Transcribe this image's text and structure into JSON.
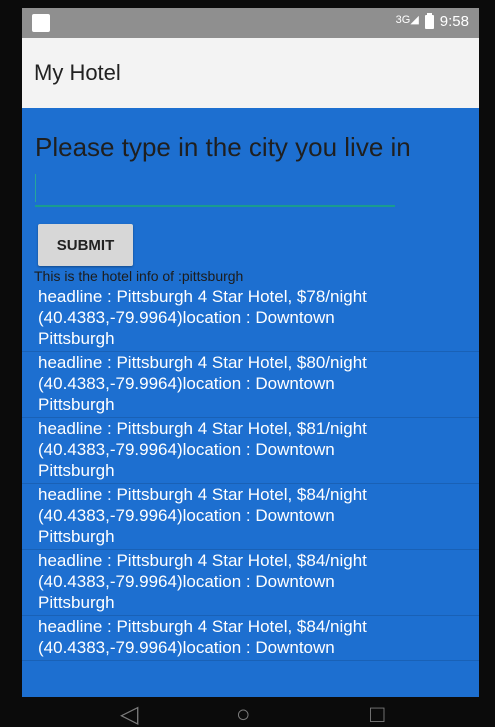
{
  "statusbar": {
    "network": "3G",
    "time": "9:58"
  },
  "appbar": {
    "title": "My Hotel"
  },
  "main": {
    "prompt": "Please type in the city you live in",
    "input": {
      "value": "",
      "placeholder": ""
    },
    "submit_label": "SUBMIT",
    "info_text": "This is the hotel info of :pittsburgh",
    "items": [
      {
        "line1": "headline : Pittsburgh 4 Star Hotel, $78/night",
        "line2": "(40.4383,-79.9964)location : Downtown",
        "line3": "Pittsburgh"
      },
      {
        "line1": "headline : Pittsburgh 4 Star Hotel, $80/night",
        "line2": "(40.4383,-79.9964)location : Downtown",
        "line3": "Pittsburgh"
      },
      {
        "line1": "headline : Pittsburgh 4 Star Hotel, $81/night",
        "line2": "(40.4383,-79.9964)location : Downtown",
        "line3": "Pittsburgh"
      },
      {
        "line1": "headline : Pittsburgh 4 Star Hotel, $84/night",
        "line2": "(40.4383,-79.9964)location : Downtown",
        "line3": "Pittsburgh"
      },
      {
        "line1": "headline : Pittsburgh 4 Star Hotel, $84/night",
        "line2": "(40.4383,-79.9964)location : Downtown",
        "line3": "Pittsburgh"
      },
      {
        "line1": "headline : Pittsburgh 4 Star Hotel, $84/night",
        "line2": "(40.4383,-79.9964)location : Downtown",
        "line3": ""
      }
    ]
  },
  "icons": {
    "status_left": "sim-card-icon",
    "signal": "signal-icon",
    "battery": "battery-icon",
    "nav_back": "back-icon",
    "nav_home": "home-icon",
    "nav_recents": "recents-icon"
  }
}
